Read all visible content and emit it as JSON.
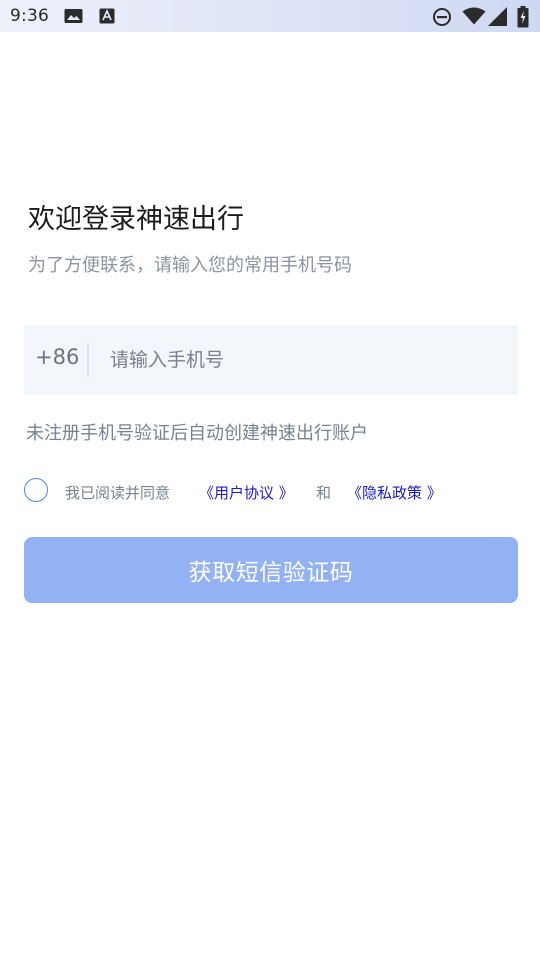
{
  "status_bar": {
    "time": "9:36",
    "icons": [
      "image-icon",
      "keyboard-a-icon",
      "do-not-disturb-icon",
      "wifi-icon",
      "cell-signal-icon",
      "battery-charging-icon"
    ]
  },
  "welcome": {
    "title": "欢迎登录神速出行",
    "subtitle": "为了方便联系，请输入您的常用手机号码"
  },
  "phone": {
    "country_code": "+86",
    "placeholder": "请输入手机号",
    "value": ""
  },
  "register_hint": "未注册手机号验证后自动创建神速出行账户",
  "agreement": {
    "checked": false,
    "prefix": "我已阅读并同意",
    "user_agreement": "《用户协议 》",
    "and": "和",
    "privacy_policy": "《隐私政策 》"
  },
  "sms_button": {
    "label": "获取短信验证码"
  },
  "colors": {
    "accent": "#4a86f0",
    "button_disabled": "#93b2f4",
    "link": "#1a1ad6",
    "input_bg": "#f3f6fb"
  }
}
